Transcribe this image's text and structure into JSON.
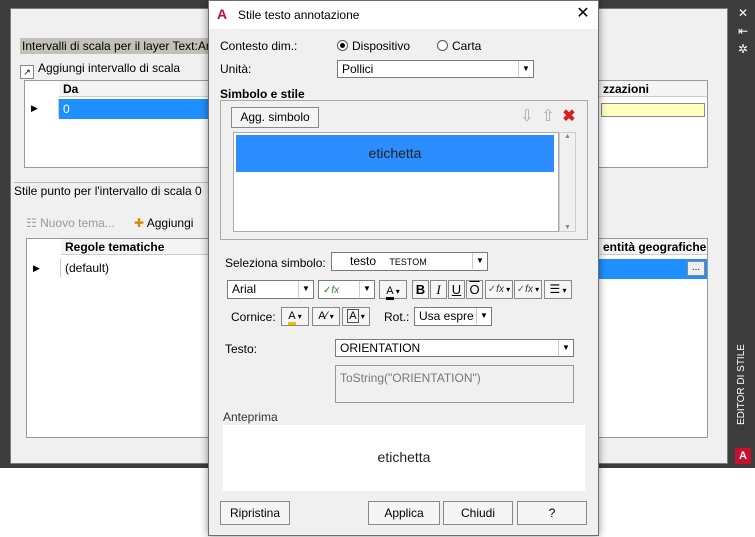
{
  "background": {
    "scale_header": "Intervalli di scala per il layer Text:Ar",
    "add_scale_label": "Aggiungi intervallo di scala",
    "scale_col_from": "Da",
    "scale_row_value": "0",
    "viz_col": "zzazioni",
    "style_header": "Stile punto per l'intervallo di scala 0",
    "new_theme_label": "Nuovo tema...",
    "add_label": "Aggiungi",
    "rules_col": "Regole tematiche",
    "rules_default": "(default)",
    "geo_col": "entità geografiche",
    "geo_button": "...",
    "side_label": "EDITOR DI STILE",
    "side_logo": "A"
  },
  "dialog": {
    "title": "Stile testo annotazione",
    "logo": "A",
    "close_glyph": "✕",
    "context_label": "Contesto dim.:",
    "context_options": [
      "Dispositivo",
      "Carta"
    ],
    "units_label": "Unità:",
    "units_value": "Pollici",
    "symbol_section_title": "Simbolo e stile",
    "add_symbol_label": "Agg. simbolo",
    "symbol_items": [
      "etichetta"
    ],
    "select_symbol_label": "Seleziona simbolo:",
    "select_symbol_value": "testo",
    "select_symbol_sub": "TESTOM",
    "font_value": "Arial",
    "bold": "B",
    "italic": "I",
    "underline": "U",
    "overline": "O",
    "frame_label": "Cornice:",
    "rotation_label": "Rot.:",
    "rotation_value": "Usa espre",
    "text_label": "Testo:",
    "text_value": "ORIENTATION",
    "expression_value": "ToString(\"ORIENTATION\")",
    "preview_label": "Anteprima",
    "preview_text": "etichetta",
    "buttons": {
      "reset": "Ripristina",
      "apply": "Applica",
      "close": "Chiudi",
      "help": "?"
    }
  },
  "colors": {
    "selection": "#2b8dff",
    "brand_red": "#c8102e",
    "viz_cell": "#ffffc0"
  }
}
